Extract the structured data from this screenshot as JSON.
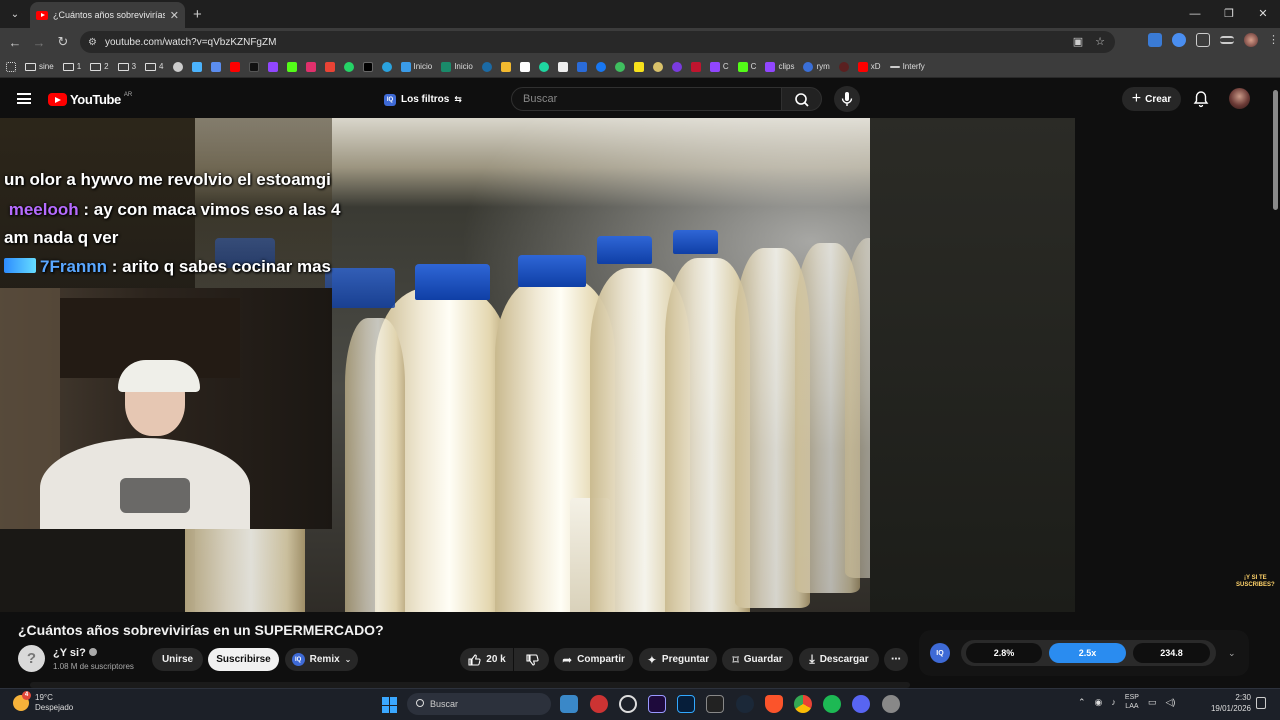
{
  "browser": {
    "tab_title": "¿Cuántos años sobrevivirías en un SUPERMERCADO?",
    "url": "youtube.com/watch?v=qVbzKZNFgZM",
    "bookmarks": [
      {
        "label": "sine",
        "icon": "folder-icon"
      },
      {
        "label": "1",
        "icon": "folder-icon"
      },
      {
        "label": "2",
        "icon": "folder-icon"
      },
      {
        "label": "3",
        "icon": "folder-icon"
      },
      {
        "label": "4",
        "icon": "folder-icon"
      },
      {
        "label": "Inicio",
        "icon": "telegram-icon"
      },
      {
        "label": "Inicio",
        "icon": "site-icon"
      },
      {
        "label": "C",
        "icon": "twitch-icon"
      },
      {
        "label": "C",
        "icon": "kick-icon"
      },
      {
        "label": "clips",
        "icon": "twitch-icon"
      },
      {
        "label": "rym",
        "icon": "site-icon"
      },
      {
        "label": "xD",
        "icon": "youtube-icon"
      },
      {
        "label": "Interfy",
        "icon": "dash-icon"
      }
    ]
  },
  "youtube": {
    "logo": "YouTube",
    "country": "AR",
    "filters_label": "Los filtros",
    "search_placeholder": "Buscar",
    "create_label": "Crear"
  },
  "video": {
    "chat_lines": [
      {
        "user": "",
        "text": "un olor a hywvo me revolvio el estoamgi"
      },
      {
        "user": "meelooh",
        "text": ": ay con maca vimos eso a las 4"
      },
      {
        "user": "",
        "text": "am nada q ver"
      },
      {
        "user": "7Frannn",
        "text": ": arito q sabes cocinar mas"
      }
    ],
    "watermark_line1": "¡Y SI TE",
    "watermark_line2": "SUSCRIBES?",
    "title": "¿Cuántos años sobrevivirías en un SUPERMERCADO?",
    "channel": "¿Y si?",
    "channel_initial": "?",
    "subscribers": "1.08 M de suscriptores",
    "join_label": "Unirse",
    "subscribe_label": "Suscribirse",
    "remix_label": "Remix",
    "likes": "20 k",
    "share_label": "Compartir",
    "ask_label": "Preguntar",
    "save_label": "Guardar",
    "download_label": "Descargar"
  },
  "extension": {
    "logo": "IQ",
    "stats": [
      "2.8%",
      "2.5x",
      "234.8"
    ],
    "active_index": 1
  },
  "taskbar": {
    "temperature": "19°C",
    "weather": "Despejado",
    "weather_badge": "4",
    "search_placeholder": "Buscar",
    "lang_line1": "ESP",
    "lang_line2": "LAA",
    "time": "2:30",
    "date": "19/01/2026"
  },
  "colors": {
    "youtube_red": "#ff0000",
    "accent_blue": "#2a8cf0",
    "chat_user_purple": "#b66cff",
    "chat_user_blue": "#5aa7ff"
  }
}
